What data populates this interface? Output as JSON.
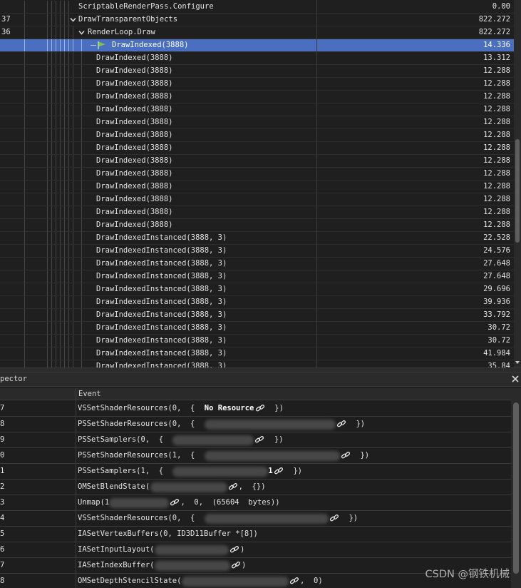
{
  "event_browser": {
    "rows": [
      {
        "eid": "",
        "depth": 0,
        "name": "ScriptableRenderPass.Configure",
        "duration": "0.00",
        "expand": false,
        "selected": false
      },
      {
        "eid": "37",
        "depth": 0,
        "name": "DrawTransparentObjects",
        "duration": "822.272",
        "expand": true,
        "selected": false
      },
      {
        "eid": "36",
        "depth": 1,
        "name": "RenderLoop.Draw",
        "duration": "822.272",
        "expand": true,
        "selected": false
      },
      {
        "eid": "",
        "depth": 2,
        "name": "DrawIndexed(3888)",
        "duration": "14.336",
        "expand": false,
        "selected": true,
        "flag": true
      },
      {
        "eid": "",
        "depth": 2,
        "name": "DrawIndexed(3888)",
        "duration": "13.312",
        "expand": false,
        "selected": false
      },
      {
        "eid": "",
        "depth": 2,
        "name": "DrawIndexed(3888)",
        "duration": "12.288",
        "expand": false,
        "selected": false
      },
      {
        "eid": "",
        "depth": 2,
        "name": "DrawIndexed(3888)",
        "duration": "12.288",
        "expand": false,
        "selected": false
      },
      {
        "eid": "",
        "depth": 2,
        "name": "DrawIndexed(3888)",
        "duration": "12.288",
        "expand": false,
        "selected": false
      },
      {
        "eid": "",
        "depth": 2,
        "name": "DrawIndexed(3888)",
        "duration": "12.288",
        "expand": false,
        "selected": false
      },
      {
        "eid": "",
        "depth": 2,
        "name": "DrawIndexed(3888)",
        "duration": "12.288",
        "expand": false,
        "selected": false
      },
      {
        "eid": "",
        "depth": 2,
        "name": "DrawIndexed(3888)",
        "duration": "12.288",
        "expand": false,
        "selected": false
      },
      {
        "eid": "",
        "depth": 2,
        "name": "DrawIndexed(3888)",
        "duration": "12.288",
        "expand": false,
        "selected": false
      },
      {
        "eid": "",
        "depth": 2,
        "name": "DrawIndexed(3888)",
        "duration": "12.288",
        "expand": false,
        "selected": false
      },
      {
        "eid": "",
        "depth": 2,
        "name": "DrawIndexed(3888)",
        "duration": "12.288",
        "expand": false,
        "selected": false
      },
      {
        "eid": "",
        "depth": 2,
        "name": "DrawIndexed(3888)",
        "duration": "12.288",
        "expand": false,
        "selected": false
      },
      {
        "eid": "",
        "depth": 2,
        "name": "DrawIndexed(3888)",
        "duration": "12.288",
        "expand": false,
        "selected": false
      },
      {
        "eid": "",
        "depth": 2,
        "name": "DrawIndexed(3888)",
        "duration": "12.288",
        "expand": false,
        "selected": false
      },
      {
        "eid": "",
        "depth": 2,
        "name": "DrawIndexed(3888)",
        "duration": "12.288",
        "expand": false,
        "selected": false
      },
      {
        "eid": "",
        "depth": 2,
        "name": "DrawIndexedInstanced(3888, 3)",
        "duration": "22.528",
        "expand": false,
        "selected": false
      },
      {
        "eid": "",
        "depth": 2,
        "name": "DrawIndexedInstanced(3888, 3)",
        "duration": "24.576",
        "expand": false,
        "selected": false
      },
      {
        "eid": "",
        "depth": 2,
        "name": "DrawIndexedInstanced(3888, 3)",
        "duration": "27.648",
        "expand": false,
        "selected": false
      },
      {
        "eid": "",
        "depth": 2,
        "name": "DrawIndexedInstanced(3888, 3)",
        "duration": "27.648",
        "expand": false,
        "selected": false
      },
      {
        "eid": "",
        "depth": 2,
        "name": "DrawIndexedInstanced(3888, 3)",
        "duration": "29.696",
        "expand": false,
        "selected": false
      },
      {
        "eid": "",
        "depth": 2,
        "name": "DrawIndexedInstanced(3888, 3)",
        "duration": "39.936",
        "expand": false,
        "selected": false
      },
      {
        "eid": "",
        "depth": 2,
        "name": "DrawIndexedInstanced(3888, 3)",
        "duration": "33.792",
        "expand": false,
        "selected": false
      },
      {
        "eid": "",
        "depth": 2,
        "name": "DrawIndexedInstanced(3888, 3)",
        "duration": "30.72",
        "expand": false,
        "selected": false
      },
      {
        "eid": "",
        "depth": 2,
        "name": "DrawIndexedInstanced(3888, 3)",
        "duration": "30.72",
        "expand": false,
        "selected": false
      },
      {
        "eid": "",
        "depth": 2,
        "name": "DrawIndexedInstanced(3888, 3)",
        "duration": "41.984",
        "expand": false,
        "selected": false
      },
      {
        "eid": "",
        "depth": 2,
        "name": "DrawIndexedInstanced(3888, 3)",
        "duration": "35.84",
        "expand": false,
        "selected": false
      }
    ]
  },
  "inspector": {
    "title": "pector",
    "close_icon": "close-icon",
    "columns": {
      "id": "",
      "event": "Event"
    },
    "rows": [
      {
        "id": "7",
        "segments": [
          {
            "t": "VSSetShaderResources(0,  {  "
          },
          {
            "t": "No Resource",
            "bold": true
          },
          {
            "link": true,
            "gap": 0
          },
          {
            "t": "  })"
          }
        ]
      },
      {
        "id": "8",
        "segments": [
          {
            "t": "PSSetShaderResources(0,  {  "
          },
          {
            "blur": 184
          },
          {
            "link": true,
            "gap": 0
          },
          {
            "t": "  })"
          }
        ]
      },
      {
        "id": "9",
        "segments": [
          {
            "t": "PSSetSamplers(0,  {  "
          },
          {
            "blur": 114
          },
          {
            "link": true,
            "gap": 0
          },
          {
            "t": "  })"
          }
        ]
      },
      {
        "id": "0",
        "segments": [
          {
            "t": "PSSetShaderResources(1,  {  "
          },
          {
            "blur": 190
          },
          {
            "link": true,
            "gap": 0
          },
          {
            "t": "  })"
          }
        ]
      },
      {
        "id": "1",
        "segments": [
          {
            "t": "PSSetSamplers(1,  {  "
          },
          {
            "blur": 134
          },
          {
            "t": "1",
            "bold": true
          },
          {
            "link": true,
            "gap": 0
          },
          {
            "t": "  })"
          }
        ]
      },
      {
        "id": "2",
        "segments": [
          {
            "t": "OMSetBlendState("
          },
          {
            "blur": 108
          },
          {
            "link": true,
            "gap": 0
          },
          {
            "t": ",  {})"
          }
        ]
      },
      {
        "id": "3",
        "segments": [
          {
            "t": "Unmap(1"
          },
          {
            "blur": 84
          },
          {
            "link": true,
            "gap": 0
          },
          {
            "t": ",  0,  (65604  bytes))"
          }
        ]
      },
      {
        "id": "4",
        "segments": [
          {
            "t": "VSSetShaderResources(0,  {  "
          },
          {
            "blur": 174
          },
          {
            "link": true,
            "gap": 0
          },
          {
            "t": "  })"
          }
        ]
      },
      {
        "id": "5",
        "segments": [
          {
            "t": "IASetVertexBuffers(0, ID3D11Buffer *[8])"
          }
        ]
      },
      {
        "id": "6",
        "segments": [
          {
            "t": "IASetInputLayout("
          },
          {
            "blur": 104
          },
          {
            "link": true,
            "gap": 0
          },
          {
            "t": ")"
          }
        ]
      },
      {
        "id": "7",
        "segments": [
          {
            "t": "IASetIndexBuffer("
          },
          {
            "blur": 106
          },
          {
            "link": true,
            "gap": 0
          },
          {
            "t": ")"
          }
        ]
      },
      {
        "id": "8",
        "segments": [
          {
            "t": "OMSetDepthStencilState("
          },
          {
            "blur": 150
          },
          {
            "link": true,
            "gap": 0
          },
          {
            "t": ",  0)"
          }
        ]
      }
    ]
  },
  "watermark": "CSDN @钢铁机械",
  "colors": {
    "selection": "#4a6fc1",
    "flag": "#7ec24a",
    "background": "#1e1e1e"
  }
}
